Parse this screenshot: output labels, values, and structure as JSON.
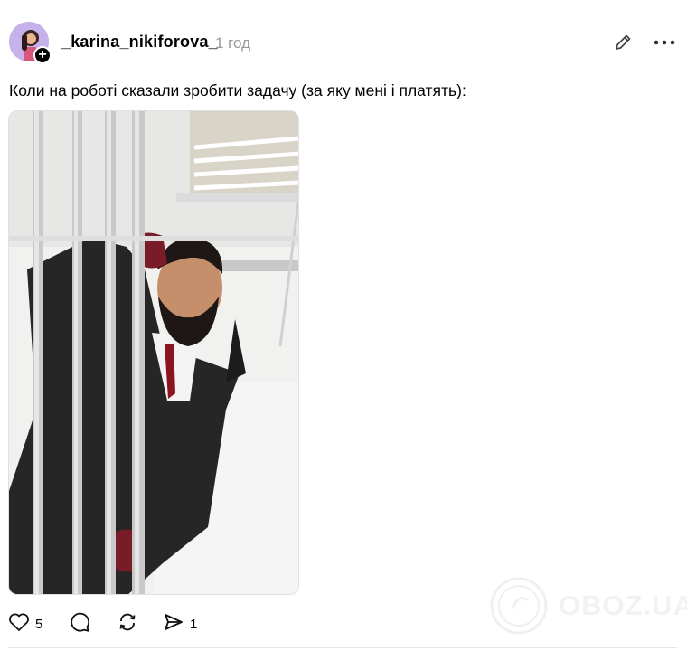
{
  "post": {
    "username": "_karina_nikiforova_",
    "time": "1 год",
    "caption": "Коли на роботі сказали зробити задачу (за яку мені і платять):",
    "likes": "5",
    "shares": "1"
  },
  "icons": {
    "follow": "plus-icon",
    "edit": "pencil-icon",
    "more": "more-dots-icon",
    "like": "heart-icon",
    "comment": "comment-bubble-icon",
    "repost": "repost-arrows-icon",
    "share": "send-icon"
  },
  "watermark": {
    "text": "OBOZ.UA"
  }
}
